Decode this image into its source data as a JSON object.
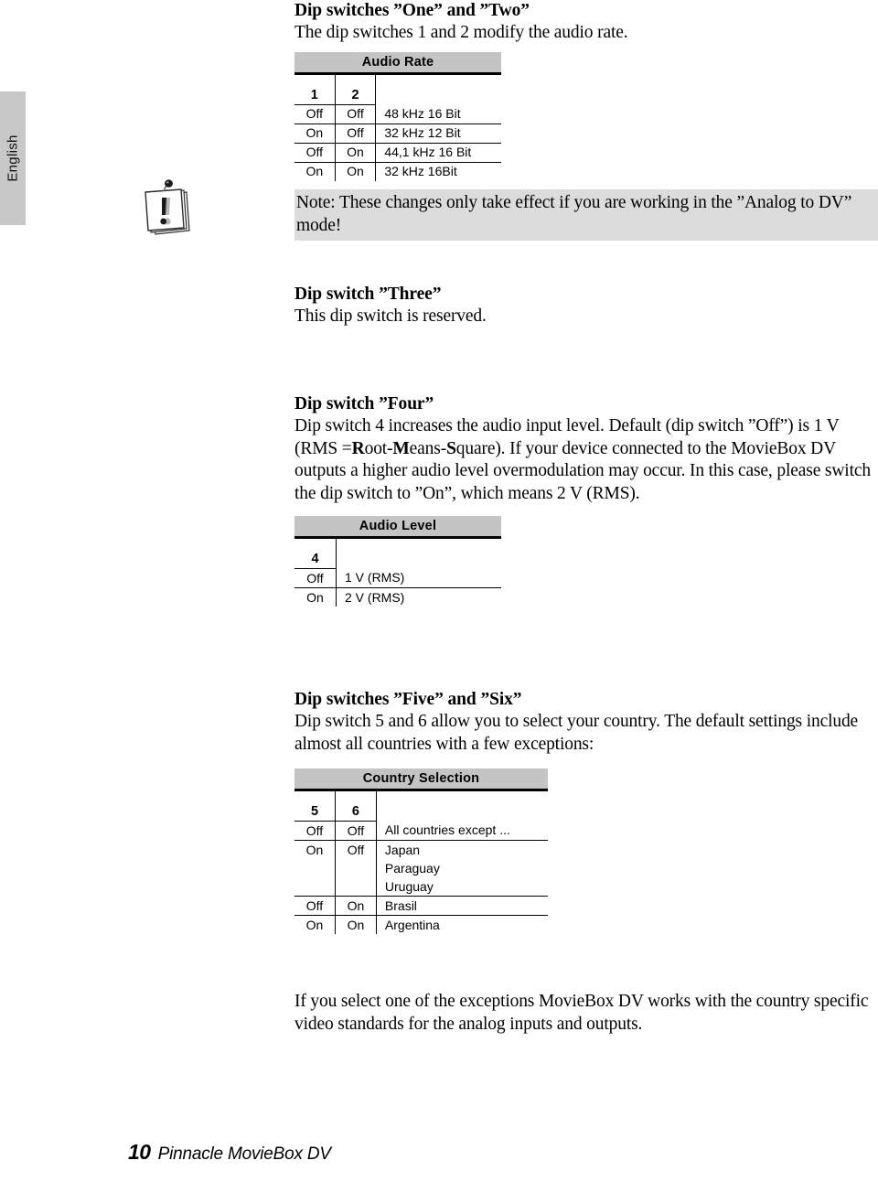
{
  "sidebar": {
    "language_tab": "English"
  },
  "sections": {
    "one_two": {
      "heading": "Dip switches ”One” and ”Two”",
      "body": "The dip switches 1 and 2 modify the audio rate."
    },
    "three": {
      "heading": "Dip switch ”Three”",
      "body": "This dip switch is reserved."
    },
    "four": {
      "heading": "Dip switch ”Four”",
      "body_part1": "Dip switch 4 increases the audio input level. Default (dip switch ”Off”) is 1 V (RMS =",
      "body_bold_r": "R",
      "body_oot": "oot-",
      "body_bold_m": "M",
      "body_eans": "eans-",
      "body_bold_s": "S",
      "body_part2": "quare). If your device connected to the MovieBox DV outputs a higher audio level overmodulation may occur. In this case, please switch the dip switch to ”On”, which means 2 V (RMS)."
    },
    "five_six": {
      "heading": "Dip switches ”Five” and ”Six”",
      "body": "Dip switch 5 and 6 allow you to select your country. The default settings include almost all countries with a few exceptions:"
    },
    "closing": {
      "body": "If you select one of the exceptions MovieBox DV works with the country specific video standards for the analog inputs and outputs."
    }
  },
  "note": {
    "icon": "note-paper-exclamation-icon",
    "text": "Note: These changes only take effect if you are working in the ”Analog to DV” mode!",
    "background": "#dcdcdc"
  },
  "tables": {
    "audio_rate": {
      "caption": "Audio Rate",
      "switch_headers": [
        "1",
        "2"
      ],
      "rows": [
        {
          "sw": [
            "Off",
            "Off"
          ],
          "value": "48 kHz 16 Bit"
        },
        {
          "sw": [
            "On",
            "Off"
          ],
          "value": "32 kHz 12 Bit"
        },
        {
          "sw": [
            "Off",
            "On"
          ],
          "value": "44,1 kHz 16 Bit"
        },
        {
          "sw": [
            "On",
            "On"
          ],
          "value": "32 kHz 16Bit"
        }
      ]
    },
    "audio_level": {
      "caption": "Audio Level",
      "switch_headers": [
        "4"
      ],
      "rows": [
        {
          "sw": [
            "Off"
          ],
          "value": "1 V (RMS)"
        },
        {
          "sw": [
            "On"
          ],
          "value": "2 V (RMS)"
        }
      ]
    },
    "country_selection": {
      "caption": "Country Selection",
      "switch_headers": [
        "5",
        "6"
      ],
      "rows": [
        {
          "sw": [
            "Off",
            "Off"
          ],
          "value": "All countries except ..."
        },
        {
          "sw": [
            "On",
            "Off"
          ],
          "value": "Japan"
        },
        {
          "sw": [
            "",
            ""
          ],
          "value": "Paraguay"
        },
        {
          "sw": [
            "",
            ""
          ],
          "value": "Uruguay"
        },
        {
          "sw": [
            "Off",
            "On"
          ],
          "value": "Brasil"
        },
        {
          "sw": [
            "On",
            "On"
          ],
          "value": "Argentina"
        }
      ]
    }
  },
  "footer": {
    "page_number": "10",
    "title": "Pinnacle MovieBox DV"
  },
  "colors": {
    "table_header_gray": "#c4c4c4",
    "note_gray": "#dcdcdc",
    "tab_gray": "#c8c8c8",
    "rule_black": "#000000"
  }
}
